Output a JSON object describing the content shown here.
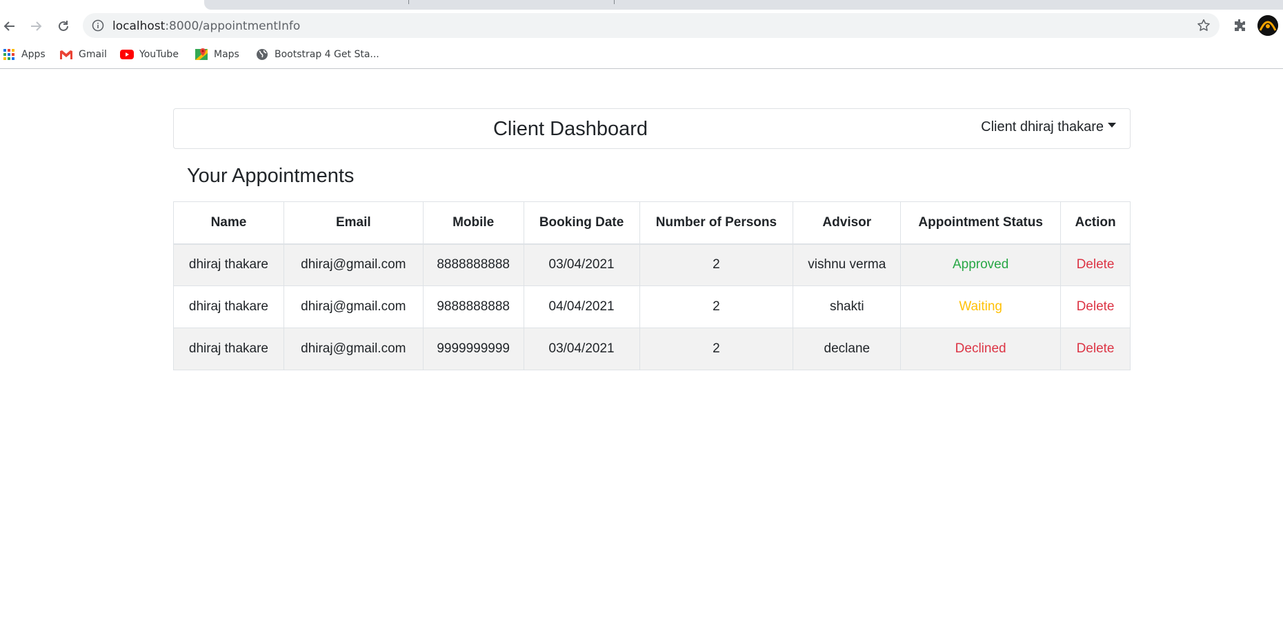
{
  "browser": {
    "url_host": "localhost",
    "url_path": ":8000/appointmentInfo",
    "bookmarks": [
      {
        "label": "Apps",
        "icon": "apps-grid-icon"
      },
      {
        "label": "Gmail",
        "icon": "gmail-icon"
      },
      {
        "label": "YouTube",
        "icon": "youtube-icon"
      },
      {
        "label": "Maps",
        "icon": "maps-icon"
      },
      {
        "label": "Bootstrap 4 Get Sta...",
        "icon": "globe-icon"
      }
    ]
  },
  "navbar": {
    "title": "Client Dashboard",
    "user_menu": "Client dhiraj thakare"
  },
  "section": {
    "title": "Your Appointments"
  },
  "table": {
    "headers": [
      "Name",
      "Email",
      "Mobile",
      "Booking Date",
      "Number of Persons",
      "Advisor",
      "Appointment Status",
      "Action"
    ],
    "rows": [
      {
        "name": "dhiraj thakare",
        "email": "dhiraj@gmail.com",
        "mobile": "8888888888",
        "date": "03/04/2021",
        "persons": "2",
        "advisor": "vishnu verma",
        "status": "Approved",
        "action": "Delete"
      },
      {
        "name": "dhiraj thakare",
        "email": "dhiraj@gmail.com",
        "mobile": "9888888888",
        "date": "04/04/2021",
        "persons": "2",
        "advisor": "shakti",
        "status": "Waiting",
        "action": "Delete"
      },
      {
        "name": "dhiraj thakare",
        "email": "dhiraj@gmail.com",
        "mobile": "9999999999",
        "date": "03/04/2021",
        "persons": "2",
        "advisor": "declane",
        "status": "Declined",
        "action": "Delete"
      }
    ]
  },
  "colors": {
    "approved": "#28a745",
    "waiting": "#ffc107",
    "declined": "#dc3545"
  }
}
